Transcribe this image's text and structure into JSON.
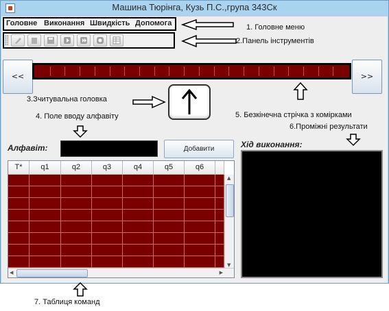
{
  "window": {
    "title": "Машина Тюрінга, Кузь П.С.,група 343Ск"
  },
  "menu": {
    "items": [
      "Головне",
      "Виконання",
      "Швидкість",
      "Допомога"
    ]
  },
  "toolbar": {
    "buttons": [
      "edit-icon",
      "delete-icon",
      "save-icon",
      "play-icon",
      "step-icon",
      "reset-icon",
      "table-icon"
    ]
  },
  "tape": {
    "left_label": "<<",
    "right_label": ">>"
  },
  "alphabet": {
    "label": "Алфавіт:",
    "input_value": "",
    "add_button": "Добавити"
  },
  "table": {
    "columns": [
      "T*",
      "q1",
      "q2",
      "q3",
      "q4",
      "q5",
      "q6"
    ]
  },
  "progress": {
    "label": "Хід виконання:"
  },
  "annotations": {
    "main_menu": "1. Головне меню",
    "toolbar": "2.Панель інструментів",
    "read_head": "3.Зчитувальна головка",
    "alphabet_input": "4. Поле вводу алфавіту",
    "tape": "5. Безкінечна стрічка з комірками",
    "progress": "6.Проміжні результати",
    "table": "7. Таблиця команд"
  },
  "colors": {
    "tape_fill": "#7a0000",
    "panel_fill": "#000000",
    "title_bar": "#a9d3ef"
  }
}
